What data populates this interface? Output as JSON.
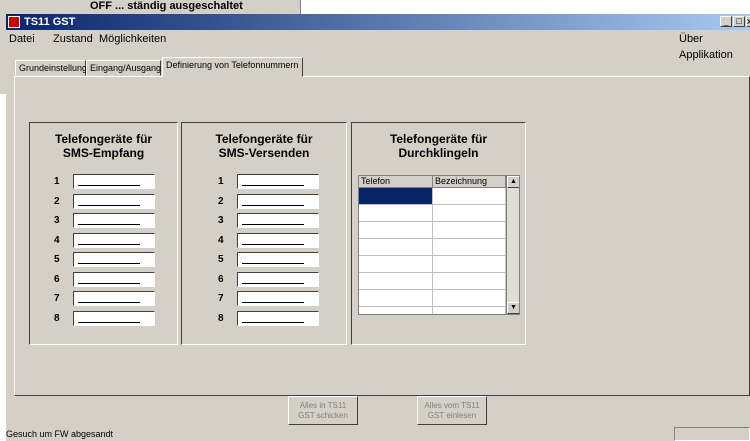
{
  "background_window": {
    "title": "OFF ... ständig ausgeschaltet"
  },
  "window": {
    "title": "TS11 GST",
    "controls": {
      "minimize": "_",
      "maximize": "□",
      "close": "x"
    }
  },
  "menu": {
    "items": [
      "Datei",
      "Zustand",
      "Möglichkeiten"
    ],
    "about": "Über Applikation"
  },
  "tabs": [
    "Grundeinstellung",
    "Eingang/Ausgang",
    "Definierung von Telefonnummern"
  ],
  "groups": {
    "sms_receive": {
      "title": "Telefongeräte für\nSMS-Empfang",
      "numbers": [
        "1",
        "2",
        "3",
        "4",
        "5",
        "6",
        "7",
        "8"
      ],
      "values": [
        "",
        "",
        "",
        "",
        "",
        "",
        "",
        ""
      ]
    },
    "sms_send": {
      "title": "Telefongeräte für\nSMS-Versenden",
      "numbers": [
        "1",
        "2",
        "3",
        "4",
        "5",
        "6",
        "7",
        "8"
      ],
      "values": [
        "",
        "",
        "",
        "",
        "",
        "",
        "",
        ""
      ]
    },
    "ring_through": {
      "title": "Telefongeräte für\nDurchklingeln",
      "columns": [
        "Telefon",
        "Bezeichnung"
      ]
    }
  },
  "buttons": {
    "send_all": "Alles in TS11\nGST schicken",
    "read_all": "Alles vom TS11\nGST einlesen"
  },
  "status": {
    "text": "Gesuch um  FW abgesandt"
  }
}
